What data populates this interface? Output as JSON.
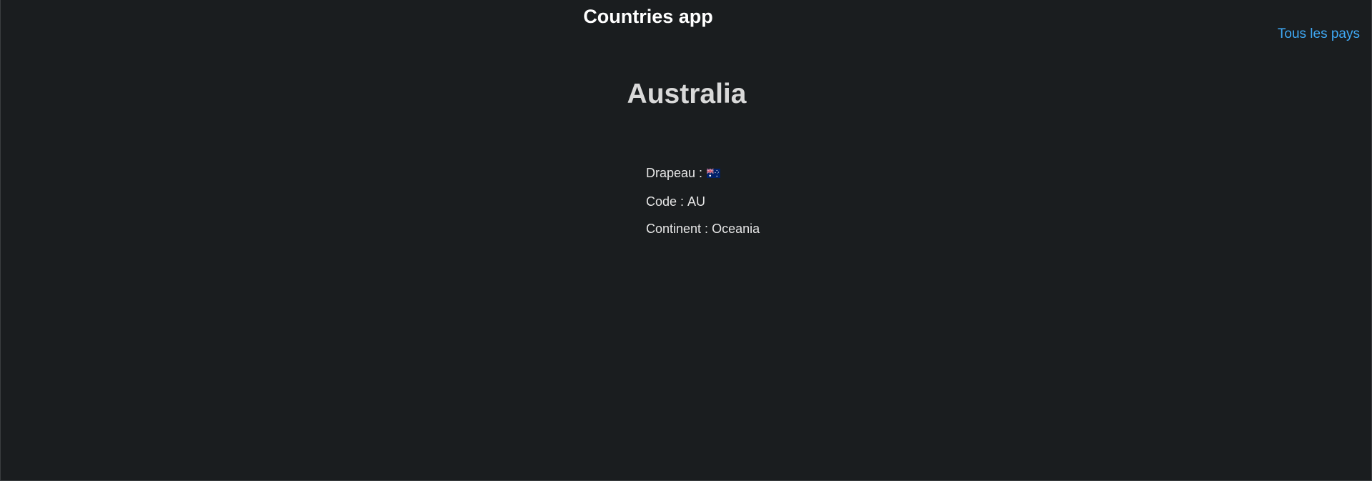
{
  "header": {
    "app_title": "Countries app",
    "nav_link": "Tous les pays"
  },
  "country": {
    "name": "Australia",
    "flag_label": "Drapeau :",
    "flag_icon": "australia-flag-icon",
    "code_label": "Code : ",
    "code": "AU",
    "continent_label": "Continent : ",
    "continent": "Oceania"
  },
  "colors": {
    "background": "#1a1d1f",
    "link": "#3fa9f5",
    "text": "#e6e6e6"
  }
}
